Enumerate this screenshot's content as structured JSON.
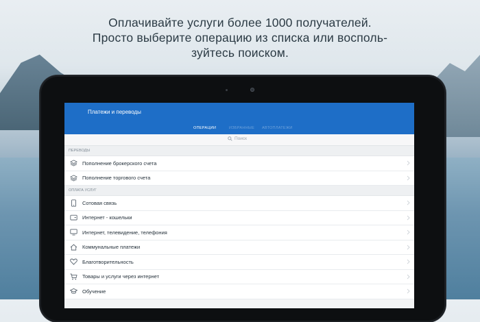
{
  "headline": {
    "line1": "Оплачивайте услуги более 1000 получателей.",
    "line2": "Просто выберите операцию из списка или восполь-",
    "line3": "зуйтесь поиском."
  },
  "app": {
    "title": "Платежи и переводы",
    "tabs": [
      {
        "label": "ОПЕРАЦИИ",
        "active": true
      },
      {
        "label": "ИЗБРАННЫЕ",
        "active": false
      },
      {
        "label": "АВТОПЛАТЕЖИ",
        "active": false
      }
    ],
    "search_placeholder": "Поиск"
  },
  "sections": [
    {
      "header": "ПЕРЕВОДЫ",
      "items": [
        {
          "label": "Пополнение брокерского счета",
          "icon": "layers-icon"
        },
        {
          "label": "Пополнение торгового счета",
          "icon": "layers-icon"
        }
      ]
    },
    {
      "header": "ОПЛАТА УСЛУГ",
      "items": [
        {
          "label": "Сотовая связь",
          "icon": "mobile-phone-icon"
        },
        {
          "label": "Интернет - кошельки",
          "icon": "wallet-icon"
        },
        {
          "label": "Интернет, телевидение, телефония",
          "icon": "monitor-icon"
        },
        {
          "label": "Коммунальные платежи",
          "icon": "house-icon"
        },
        {
          "label": "Благотворительность",
          "icon": "heart-icon"
        },
        {
          "label": "Товары и услуги через интернет",
          "icon": "shopping-cart-icon"
        },
        {
          "label": "Обучение",
          "icon": "graduation-cap-icon"
        }
      ]
    }
  ],
  "colors": {
    "appbar": "#1e6ec7",
    "text_primary": "#25313b",
    "section_text": "#7f8a94"
  }
}
